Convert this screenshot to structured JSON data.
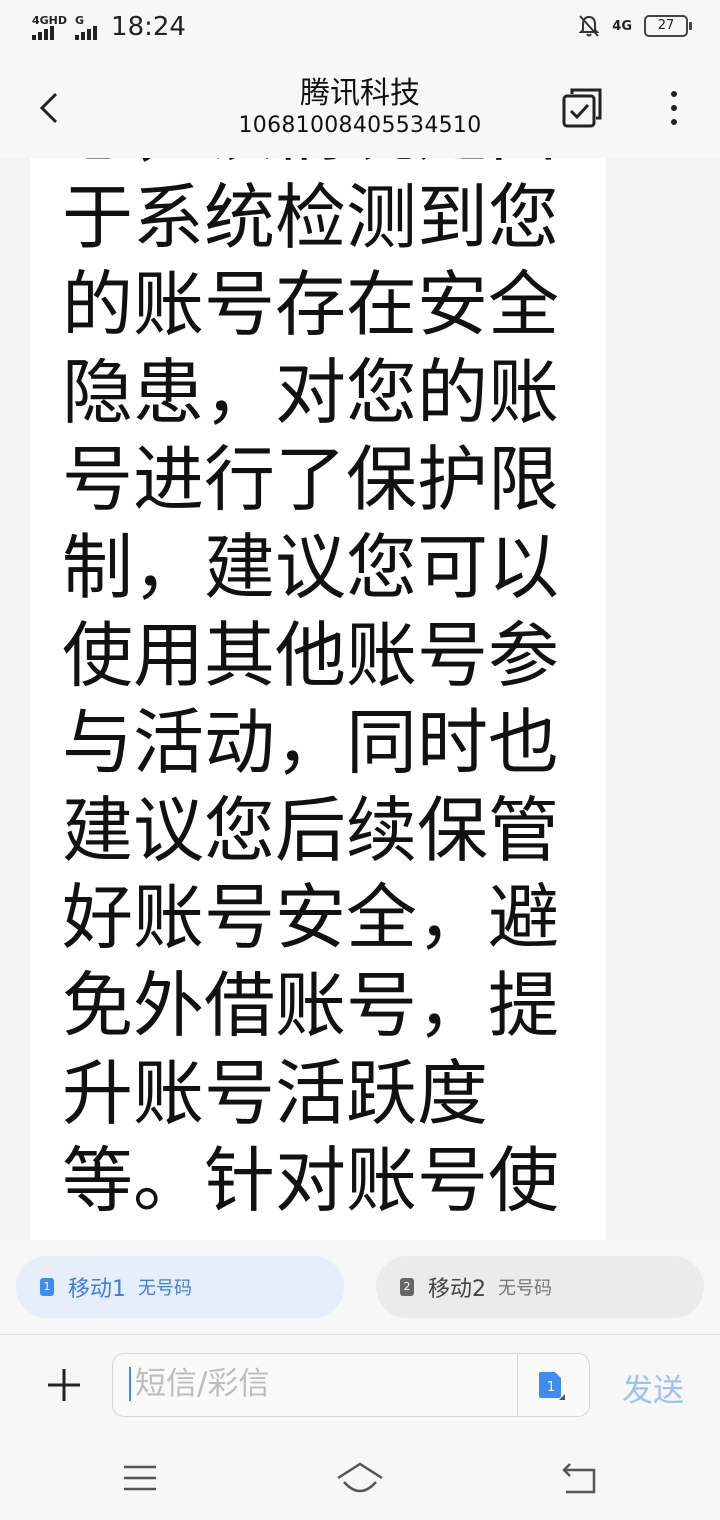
{
  "status_bar": {
    "sim1_signal_label": "4GHD",
    "sim2_signal_label": "G",
    "time": "18:24",
    "network_label": "4G",
    "battery": "27"
  },
  "header": {
    "title": "腾讯科技",
    "subtitle": "10681008405534510"
  },
  "message": {
    "text": "息，该情况是由于系统检测到您的账号存在安全隐患，对您的账号进行了保护限制，建议您可以使用其他账号参与活动，同时也建议您后续保管好账号安全，避免外借账号，提升账号活跃度等。针对账号使"
  },
  "sim_selector": {
    "sim1": {
      "badge": "1",
      "name": "移动1",
      "number": "无号码"
    },
    "sim2": {
      "badge": "2",
      "name": "移动2",
      "number": "无号码"
    }
  },
  "compose": {
    "placeholder": "短信/彩信",
    "sim_badge": "1",
    "send_label": "发送"
  },
  "colors": {
    "accent": "#3d8cf0",
    "send_disabled": "#9cc1f2",
    "sim1_bg": "#e6eef9"
  }
}
